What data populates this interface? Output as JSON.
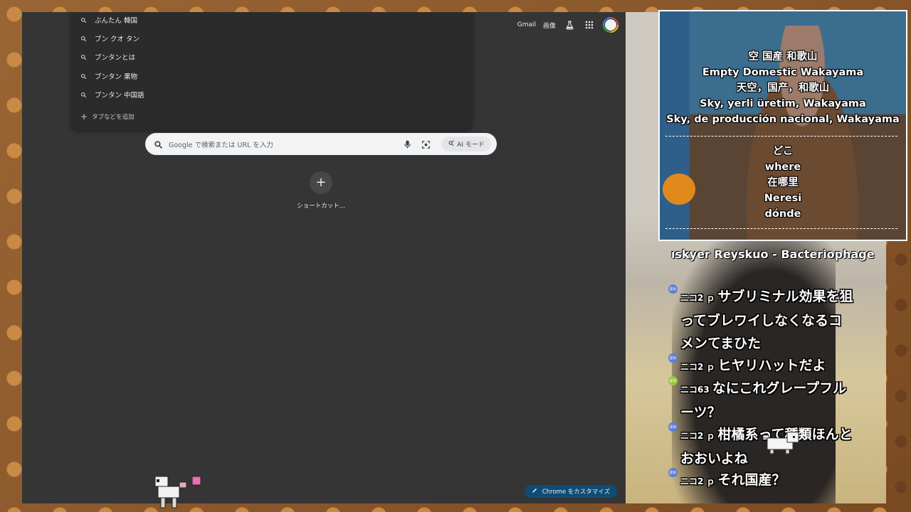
{
  "chrome": {
    "topbar": {
      "gmail": "Gmail",
      "images": "画像"
    },
    "suggestions": [
      "ぶんたん 韓国",
      "ブン クオ タン",
      "ブンタンとは",
      "ブンタン 果物",
      "ブンタン 中国語"
    ],
    "add_tab": "タブなどを追加",
    "search": {
      "placeholder": "Google で検索または URL を入力",
      "ai_mode": "AI モード"
    },
    "shortcut_label": "ショートカット...",
    "customize": "Chrome をカスタマイズ"
  },
  "stream": {
    "cam_subtitles_top": [
      "空 国産 和歌山",
      "Empty Domestic Wakayama",
      "天空，国产，和歌山",
      "Sky, yerli üretim, Wakayama",
      "Sky, de producción nacional, Wakayama"
    ],
    "cam_subtitles_bottom": [
      "どこ",
      "where",
      "在哪里",
      "Neresi",
      "dónde"
    ],
    "song": "ıskyer Reyskuo - Bacteriophage",
    "comments": [
      {
        "user": "ニコ2 ｐ",
        "lines": [
          "サブリミナル効果を狙",
          "ってブレワイしなくなるコ",
          "メンてまひた"
        ],
        "badge_color": "#5b7fd6"
      },
      {
        "user": "ニコ2 ｐ",
        "lines": [
          "ヒヤリハットだよ"
        ],
        "badge_color": "#5b7fd6"
      },
      {
        "user": "ニコ63",
        "lines": [
          "なにこれグレープフル",
          "ーツ？"
        ],
        "badge_color": "#9bc43a"
      },
      {
        "user": "ニコ2 ｐ",
        "lines": [
          "柑橘系って種類ほんと",
          "おおいよね"
        ],
        "badge_color": "#5b7fd6"
      },
      {
        "user": "ニコ2 ｐ",
        "lines": [
          "それ国産？"
        ],
        "badge_color": "#5b7fd6"
      }
    ],
    "badge_text": "認め"
  }
}
